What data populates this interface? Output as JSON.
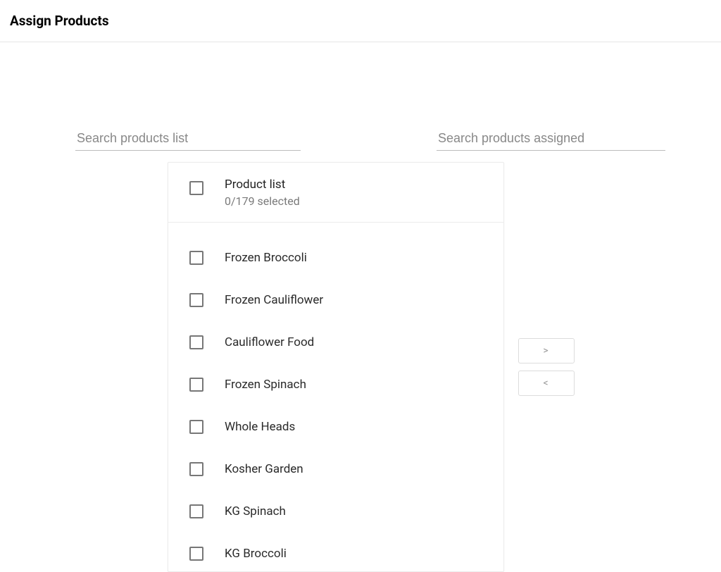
{
  "header": {
    "title": "Assign Products"
  },
  "search": {
    "left_placeholder": "Search products list",
    "right_placeholder": "Search products assigned"
  },
  "panel": {
    "title": "Product list",
    "selected_text": "0/179 selected",
    "items": [
      "Frozen Broccoli",
      "Frozen Cauliflower",
      "Cauliflower Food",
      "Frozen Spinach",
      "Whole Heads",
      "Kosher Garden",
      "KG Spinach",
      "KG Broccoli"
    ]
  },
  "transfer": {
    "add": ">",
    "remove": "<"
  }
}
